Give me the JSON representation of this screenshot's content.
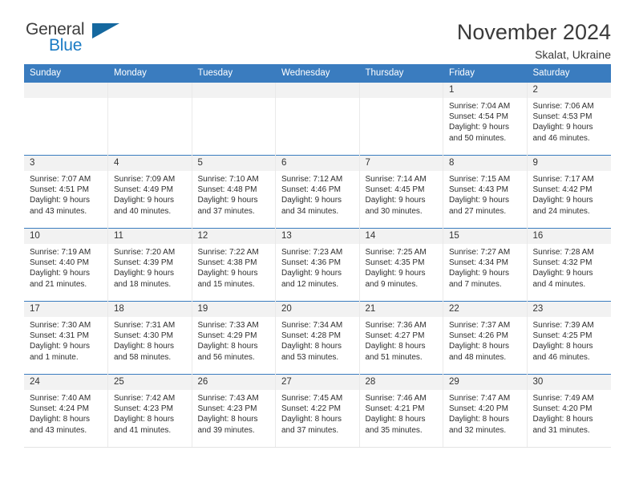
{
  "brand": {
    "name_part1": "General",
    "name_part2": "Blue",
    "accent_color": "#1a7bc4",
    "triangle_color": "#15689f"
  },
  "header": {
    "title": "November 2024",
    "subtitle": "Skalat, Ukraine"
  },
  "theme": {
    "header_row_bg": "#3a7cbf",
    "daynum_bg": "#f2f2f2",
    "text_color": "#2e2e2e"
  },
  "weekdays": [
    "Sunday",
    "Monday",
    "Tuesday",
    "Wednesday",
    "Thursday",
    "Friday",
    "Saturday"
  ],
  "weeks": [
    [
      {
        "day": "",
        "empty": true
      },
      {
        "day": "",
        "empty": true
      },
      {
        "day": "",
        "empty": true
      },
      {
        "day": "",
        "empty": true
      },
      {
        "day": "",
        "empty": true
      },
      {
        "day": "1",
        "sunrise": "Sunrise: 7:04 AM",
        "sunset": "Sunset: 4:54 PM",
        "daylight": "Daylight: 9 hours and 50 minutes."
      },
      {
        "day": "2",
        "sunrise": "Sunrise: 7:06 AM",
        "sunset": "Sunset: 4:53 PM",
        "daylight": "Daylight: 9 hours and 46 minutes."
      }
    ],
    [
      {
        "day": "3",
        "sunrise": "Sunrise: 7:07 AM",
        "sunset": "Sunset: 4:51 PM",
        "daylight": "Daylight: 9 hours and 43 minutes."
      },
      {
        "day": "4",
        "sunrise": "Sunrise: 7:09 AM",
        "sunset": "Sunset: 4:49 PM",
        "daylight": "Daylight: 9 hours and 40 minutes."
      },
      {
        "day": "5",
        "sunrise": "Sunrise: 7:10 AM",
        "sunset": "Sunset: 4:48 PM",
        "daylight": "Daylight: 9 hours and 37 minutes."
      },
      {
        "day": "6",
        "sunrise": "Sunrise: 7:12 AM",
        "sunset": "Sunset: 4:46 PM",
        "daylight": "Daylight: 9 hours and 34 minutes."
      },
      {
        "day": "7",
        "sunrise": "Sunrise: 7:14 AM",
        "sunset": "Sunset: 4:45 PM",
        "daylight": "Daylight: 9 hours and 30 minutes."
      },
      {
        "day": "8",
        "sunrise": "Sunrise: 7:15 AM",
        "sunset": "Sunset: 4:43 PM",
        "daylight": "Daylight: 9 hours and 27 minutes."
      },
      {
        "day": "9",
        "sunrise": "Sunrise: 7:17 AM",
        "sunset": "Sunset: 4:42 PM",
        "daylight": "Daylight: 9 hours and 24 minutes."
      }
    ],
    [
      {
        "day": "10",
        "sunrise": "Sunrise: 7:19 AM",
        "sunset": "Sunset: 4:40 PM",
        "daylight": "Daylight: 9 hours and 21 minutes."
      },
      {
        "day": "11",
        "sunrise": "Sunrise: 7:20 AM",
        "sunset": "Sunset: 4:39 PM",
        "daylight": "Daylight: 9 hours and 18 minutes."
      },
      {
        "day": "12",
        "sunrise": "Sunrise: 7:22 AM",
        "sunset": "Sunset: 4:38 PM",
        "daylight": "Daylight: 9 hours and 15 minutes."
      },
      {
        "day": "13",
        "sunrise": "Sunrise: 7:23 AM",
        "sunset": "Sunset: 4:36 PM",
        "daylight": "Daylight: 9 hours and 12 minutes."
      },
      {
        "day": "14",
        "sunrise": "Sunrise: 7:25 AM",
        "sunset": "Sunset: 4:35 PM",
        "daylight": "Daylight: 9 hours and 9 minutes."
      },
      {
        "day": "15",
        "sunrise": "Sunrise: 7:27 AM",
        "sunset": "Sunset: 4:34 PM",
        "daylight": "Daylight: 9 hours and 7 minutes."
      },
      {
        "day": "16",
        "sunrise": "Sunrise: 7:28 AM",
        "sunset": "Sunset: 4:32 PM",
        "daylight": "Daylight: 9 hours and 4 minutes."
      }
    ],
    [
      {
        "day": "17",
        "sunrise": "Sunrise: 7:30 AM",
        "sunset": "Sunset: 4:31 PM",
        "daylight": "Daylight: 9 hours and 1 minute."
      },
      {
        "day": "18",
        "sunrise": "Sunrise: 7:31 AM",
        "sunset": "Sunset: 4:30 PM",
        "daylight": "Daylight: 8 hours and 58 minutes."
      },
      {
        "day": "19",
        "sunrise": "Sunrise: 7:33 AM",
        "sunset": "Sunset: 4:29 PM",
        "daylight": "Daylight: 8 hours and 56 minutes."
      },
      {
        "day": "20",
        "sunrise": "Sunrise: 7:34 AM",
        "sunset": "Sunset: 4:28 PM",
        "daylight": "Daylight: 8 hours and 53 minutes."
      },
      {
        "day": "21",
        "sunrise": "Sunrise: 7:36 AM",
        "sunset": "Sunset: 4:27 PM",
        "daylight": "Daylight: 8 hours and 51 minutes."
      },
      {
        "day": "22",
        "sunrise": "Sunrise: 7:37 AM",
        "sunset": "Sunset: 4:26 PM",
        "daylight": "Daylight: 8 hours and 48 minutes."
      },
      {
        "day": "23",
        "sunrise": "Sunrise: 7:39 AM",
        "sunset": "Sunset: 4:25 PM",
        "daylight": "Daylight: 8 hours and 46 minutes."
      }
    ],
    [
      {
        "day": "24",
        "sunrise": "Sunrise: 7:40 AM",
        "sunset": "Sunset: 4:24 PM",
        "daylight": "Daylight: 8 hours and 43 minutes."
      },
      {
        "day": "25",
        "sunrise": "Sunrise: 7:42 AM",
        "sunset": "Sunset: 4:23 PM",
        "daylight": "Daylight: 8 hours and 41 minutes."
      },
      {
        "day": "26",
        "sunrise": "Sunrise: 7:43 AM",
        "sunset": "Sunset: 4:23 PM",
        "daylight": "Daylight: 8 hours and 39 minutes."
      },
      {
        "day": "27",
        "sunrise": "Sunrise: 7:45 AM",
        "sunset": "Sunset: 4:22 PM",
        "daylight": "Daylight: 8 hours and 37 minutes."
      },
      {
        "day": "28",
        "sunrise": "Sunrise: 7:46 AM",
        "sunset": "Sunset: 4:21 PM",
        "daylight": "Daylight: 8 hours and 35 minutes."
      },
      {
        "day": "29",
        "sunrise": "Sunrise: 7:47 AM",
        "sunset": "Sunset: 4:20 PM",
        "daylight": "Daylight: 8 hours and 32 minutes."
      },
      {
        "day": "30",
        "sunrise": "Sunrise: 7:49 AM",
        "sunset": "Sunset: 4:20 PM",
        "daylight": "Daylight: 8 hours and 31 minutes."
      }
    ]
  ]
}
